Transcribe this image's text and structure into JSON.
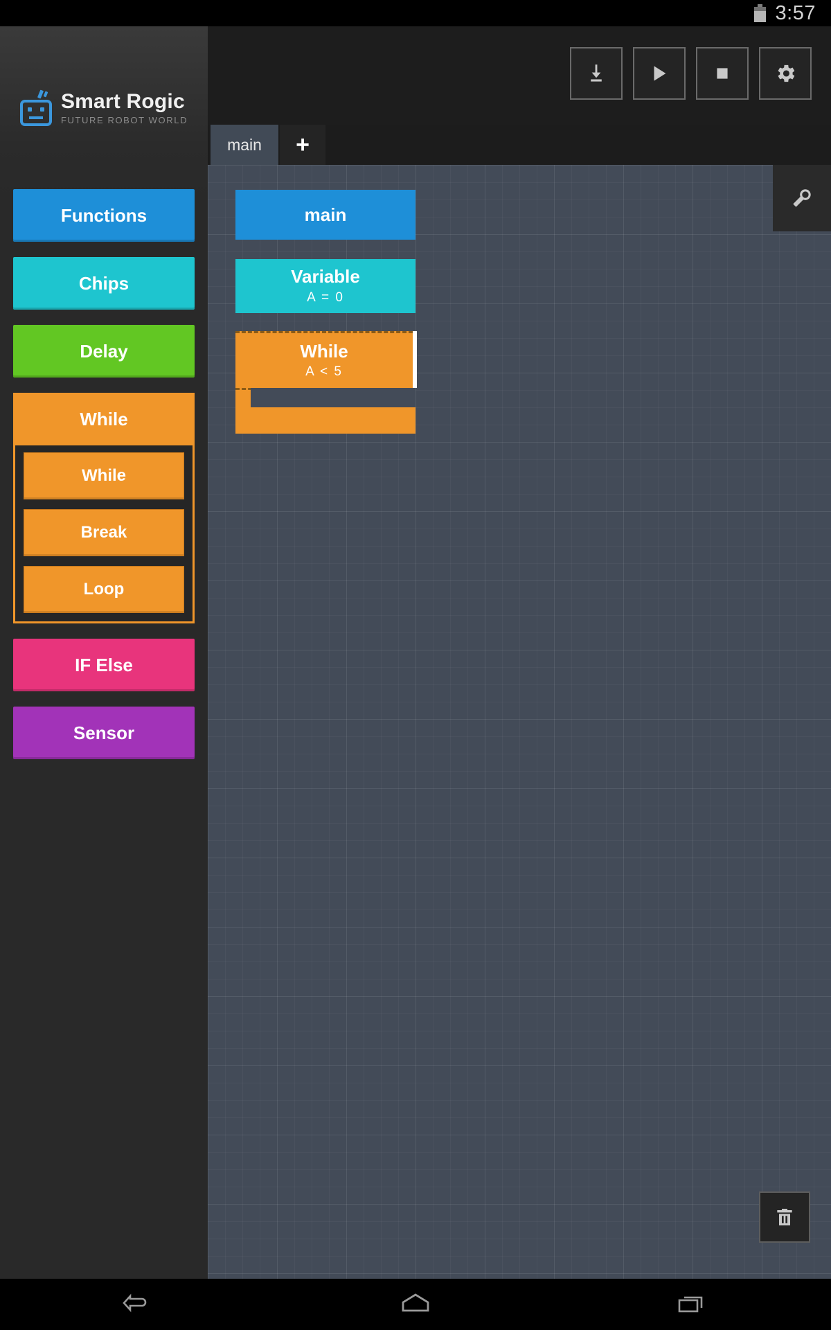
{
  "status_bar": {
    "time": "3:57",
    "battery_icon": "battery-icon"
  },
  "sidebar": {
    "logo": {
      "title": "Smart Rogic",
      "subtitle": "FUTURE ROBOT WORLD",
      "icon": "robot-icon"
    },
    "palette": [
      {
        "label": "Functions",
        "color": "#1e8fd8",
        "key": "functions"
      },
      {
        "label": "Chips",
        "color": "#1ec5cf",
        "key": "chips"
      },
      {
        "label": "Delay",
        "color": "#62c723",
        "key": "delay"
      }
    ],
    "expanded_group": {
      "label": "While",
      "color": "#f0962a",
      "items": [
        {
          "label": "While",
          "key": "while"
        },
        {
          "label": "Break",
          "key": "break"
        },
        {
          "label": "Loop",
          "key": "loop"
        }
      ]
    },
    "palette_bottom": [
      {
        "label": "IF Else",
        "color": "#e8347c",
        "key": "if-else"
      },
      {
        "label": "Sensor",
        "color": "#a233b8",
        "key": "sensor"
      }
    ]
  },
  "toolbar": {
    "buttons": [
      {
        "icon": "download-icon",
        "key": "download"
      },
      {
        "icon": "play-icon",
        "key": "run"
      },
      {
        "icon": "stop-icon",
        "key": "stop"
      },
      {
        "icon": "gear-icon",
        "key": "settings"
      }
    ]
  },
  "tabs": {
    "active": "main",
    "add_label": "+"
  },
  "canvas": {
    "wrench_icon": "wrench-icon",
    "trash_icon": "trash-icon",
    "blocks": [
      {
        "type": "main",
        "title": "main",
        "subtitle": "",
        "color": "#1e8fd8"
      },
      {
        "type": "variable",
        "title": "Variable",
        "subtitle": "A = 0",
        "color": "#1ec5cf"
      },
      {
        "type": "while",
        "title": "While",
        "subtitle": "A < 5",
        "color": "#f0962a",
        "selected": true
      }
    ]
  },
  "navbar": {
    "buttons": [
      {
        "icon": "back-icon",
        "key": "back"
      },
      {
        "icon": "home-icon",
        "key": "home"
      },
      {
        "icon": "recents-icon",
        "key": "recents"
      }
    ]
  }
}
